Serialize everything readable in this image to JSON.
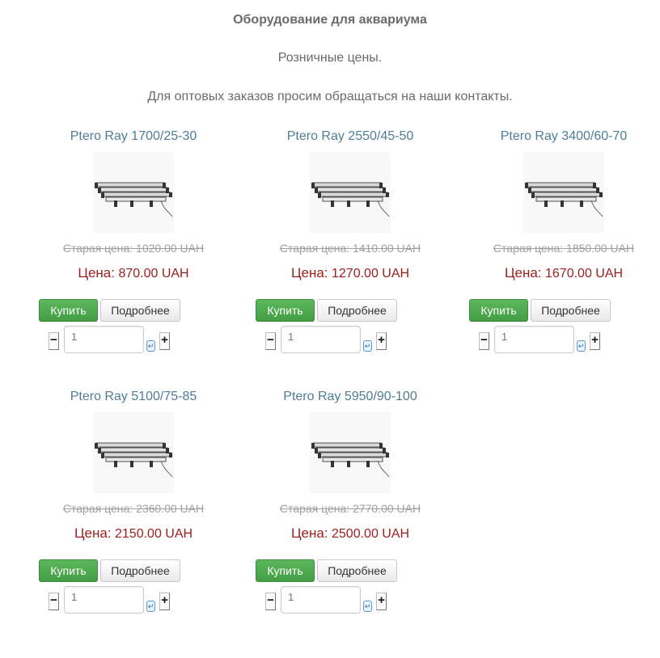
{
  "header": {
    "title": "Оборудование для аквариума",
    "retail": "Розничные цены.",
    "wholesale": "Для оптовых заказов просим обращаться на наши контакты."
  },
  "colors": {
    "product_link": "#4e7d96",
    "price": "#9b1e1e",
    "buy_button": "#5cb85c"
  },
  "labels": {
    "old_price": "Старая цена:",
    "price": "Цена:",
    "buy": "Купить",
    "details": "Подробнее",
    "minus": "−",
    "plus": "+",
    "enter": "↵"
  },
  "products": [
    {
      "name": "Ptero Ray 1700/25-30",
      "old_price": "1020.00 UAH",
      "price": "870.00 UAH",
      "qty_placeholder": "1"
    },
    {
      "name": "Ptero Ray 2550/45-50",
      "old_price": "1410.00 UAH",
      "price": "1270.00 UAH",
      "qty_placeholder": "1"
    },
    {
      "name": "Ptero Ray 3400/60-70",
      "old_price": "1850.00 UAH",
      "price": "1670.00 UAH",
      "qty_placeholder": "1"
    },
    {
      "name": "Ptero Ray 5100/75-85",
      "old_price": "2360.00 UAH",
      "price": "2150.00 UAH",
      "qty_placeholder": "1"
    },
    {
      "name": "Ptero Ray 5950/90-100",
      "old_price": "2770.00 UAH",
      "price": "2500.00 UAH",
      "qty_placeholder": "1"
    }
  ]
}
